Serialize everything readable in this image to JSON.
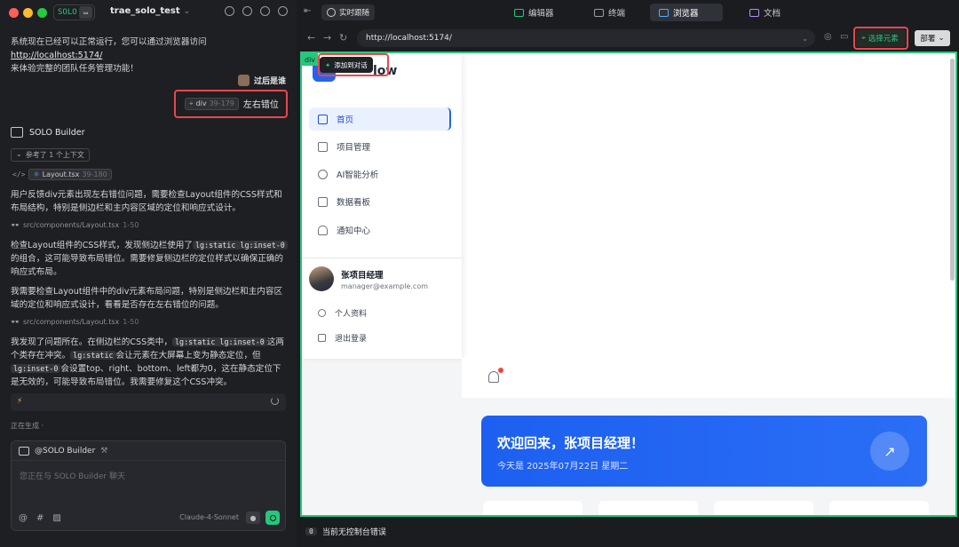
{
  "colors": {
    "accent_green": "#27c77b",
    "highlight_red": "#e8484d",
    "brand_blue": "#2563eb"
  },
  "titlebar": {
    "solo_label": "SOLO",
    "project": "trae_solo_test"
  },
  "chat": {
    "intro_text": "系统现在已经可以正常运行，您可以通过浏览器访问",
    "intro_link": "http://localhost:5174/",
    "intro_text2": "来体验完整的团队任务管理功能！",
    "user_name": "过后是谁",
    "user_chip_tag": "div",
    "user_chip_range": "39-179",
    "user_message": "左右错位",
    "agent_name": "SOLO Builder",
    "context_label": "参考了 1 个上下文",
    "context_file": "Layout.tsx",
    "context_range": "39-180",
    "p1": "用户反馈div元素出现左右错位问题，需要检查Layout组件的CSS样式和布局结构，特别是侧边栏和主内容区域的定位和响应式设计。",
    "read1_path": "src/components/Layout.tsx",
    "read1_range": "1-50",
    "p2_a": "检查Layout组件的CSS样式，发现侧边栏使用了",
    "p2_code": "lg:static lg:inset-0",
    "p2_b": "的组合，这可能导致布局错位。需要修复侧边栏的定位样式以确保正确的响应式布局。",
    "p3": "我需要检查Layout组件中的div元素布局问题，特别是侧边栏和主内容区域的定位和响应式设计，看看是否存在左右错位的问题。",
    "read2_path": "src/components/Layout.tsx",
    "read2_range": "1-50",
    "p4_a": "我发现了问题所在。在侧边栏的CSS类中，",
    "p4_code1": "lg:static lg:inset-0",
    "p4_b": "这两个类存在冲突。",
    "p4_code2": "lg:static",
    "p4_c": "会让元素在大屏幕上变为静态定位，但",
    "p4_code3": "lg:inset-0",
    "p4_d": "会设置top、right、bottom、left都为0，这在静态定位下是无效的，可能导致布局错位。我需要修复这个CSS冲突。",
    "generating": "正在生成 ·"
  },
  "composer": {
    "mention": "@SOLO Builder",
    "placeholder": "您正在与 SOLO Builder 聊天",
    "model": "Claude-4-Sonnet"
  },
  "browser": {
    "live_follow": "实时跟随",
    "tabs": [
      {
        "label": "编辑器"
      },
      {
        "label": "终端"
      },
      {
        "label": "浏览器"
      },
      {
        "label": "文档"
      }
    ],
    "url": "http://localhost:5174/",
    "select_element": "选择元素",
    "deploy": "部署",
    "console_count": "0",
    "console_text": "当前无控制台错误"
  },
  "site": {
    "logo_text": "low",
    "menu": [
      {
        "label": "首页"
      },
      {
        "label": "项目管理"
      },
      {
        "label": "AI智能分析"
      },
      {
        "label": "数据看板"
      },
      {
        "label": "通知中心"
      }
    ],
    "user_name": "张项目经理",
    "user_email": "manager@example.com",
    "profile": "个人资料",
    "logout": "退出登录",
    "welcome_title": "欢迎回来，张项目经理！",
    "welcome_date": "今天是 2025年07月22日 星期二",
    "tooltip": "添加到对话",
    "div_tag": "div"
  }
}
